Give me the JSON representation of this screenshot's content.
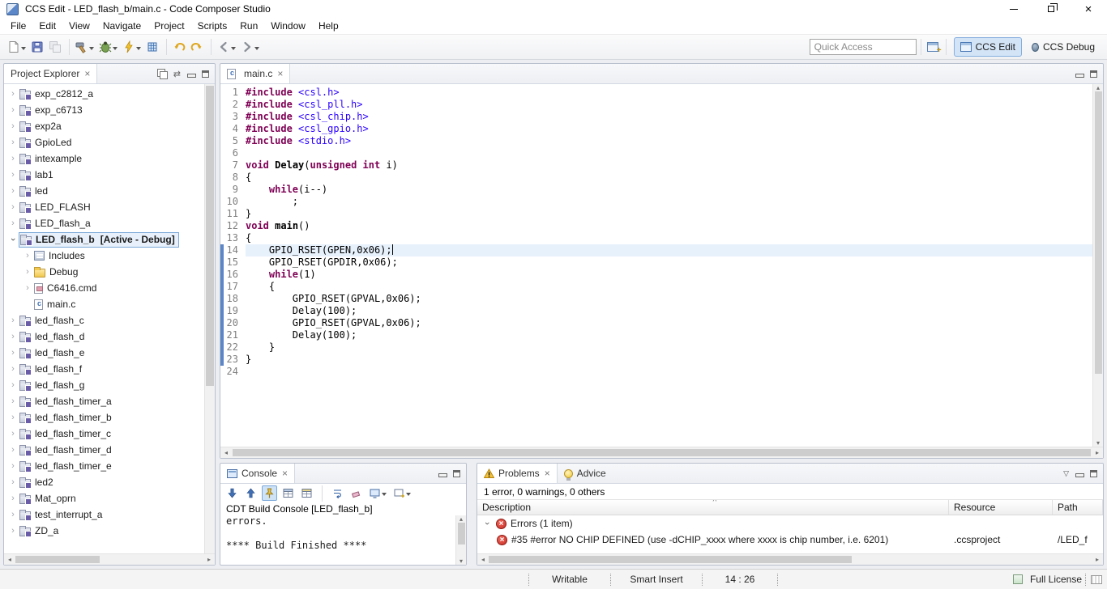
{
  "window": {
    "title": "CCS Edit - LED_flash_b/main.c - Code Composer Studio"
  },
  "menu_bar": {
    "items": [
      "File",
      "Edit",
      "View",
      "Navigate",
      "Project",
      "Scripts",
      "Run",
      "Window",
      "Help"
    ]
  },
  "toolbar": {
    "quick_access_placeholder": "Quick Access",
    "perspectives": [
      {
        "label": "CCS Edit",
        "active": true
      },
      {
        "label": "CCS Debug",
        "active": false
      }
    ]
  },
  "project_explorer": {
    "title": "Project Explorer",
    "items": [
      {
        "label": "exp_c2812_a",
        "type": "project"
      },
      {
        "label": "exp_c6713",
        "type": "project"
      },
      {
        "label": "exp2a",
        "type": "project"
      },
      {
        "label": "GpioLed",
        "type": "project"
      },
      {
        "label": "intexample",
        "type": "project"
      },
      {
        "label": "lab1",
        "type": "project"
      },
      {
        "label": "led",
        "type": "project"
      },
      {
        "label": "LED_FLASH",
        "type": "project"
      },
      {
        "label": "LED_flash_a",
        "type": "project"
      },
      {
        "label": "LED_flash_b",
        "suffix": "[Active - Debug]",
        "type": "project",
        "expanded": true,
        "selected": true,
        "children": [
          {
            "label": "Includes",
            "type": "includes"
          },
          {
            "label": "Debug",
            "type": "folder"
          },
          {
            "label": "C6416.cmd",
            "type": "cmdfile"
          },
          {
            "label": "main.c",
            "type": "cfile",
            "leaf": true
          }
        ]
      },
      {
        "label": "led_flash_c",
        "type": "project"
      },
      {
        "label": "led_flash_d",
        "type": "project"
      },
      {
        "label": "led_flash_e",
        "type": "project"
      },
      {
        "label": "led_flash_f",
        "type": "project"
      },
      {
        "label": "led_flash_g",
        "type": "project"
      },
      {
        "label": "led_flash_timer_a",
        "type": "project"
      },
      {
        "label": "led_flash_timer_b",
        "type": "project"
      },
      {
        "label": "led_flash_timer_c",
        "type": "project"
      },
      {
        "label": "led_flash_timer_d",
        "type": "project"
      },
      {
        "label": "led_flash_timer_e",
        "type": "project"
      },
      {
        "label": "led2",
        "type": "project"
      },
      {
        "label": "Mat_oprn",
        "type": "project"
      },
      {
        "label": "test_interrupt_a",
        "type": "project"
      },
      {
        "label": "ZD_a",
        "type": "project"
      }
    ]
  },
  "editor": {
    "tab": "main.c",
    "code": [
      {
        "tokens": [
          [
            "d",
            "#include"
          ],
          [
            "p",
            " "
          ],
          [
            "s",
            "<csl.h>"
          ]
        ]
      },
      {
        "tokens": [
          [
            "d",
            "#include"
          ],
          [
            "p",
            " "
          ],
          [
            "s",
            "<csl_pll.h>"
          ]
        ]
      },
      {
        "tokens": [
          [
            "d",
            "#include"
          ],
          [
            "p",
            " "
          ],
          [
            "s",
            "<csl_chip.h>"
          ]
        ]
      },
      {
        "tokens": [
          [
            "d",
            "#include"
          ],
          [
            "p",
            " "
          ],
          [
            "s",
            "<csl_gpio.h>"
          ]
        ]
      },
      {
        "tokens": [
          [
            "d",
            "#include"
          ],
          [
            "p",
            " "
          ],
          [
            "s",
            "<stdio.h>"
          ]
        ]
      },
      {
        "tokens": []
      },
      {
        "tokens": [
          [
            "k",
            "void"
          ],
          [
            "p",
            " "
          ],
          [
            "f",
            "Delay"
          ],
          [
            "p",
            "("
          ],
          [
            "k",
            "unsigned"
          ],
          [
            "p",
            " "
          ],
          [
            "k",
            "int"
          ],
          [
            "p",
            " i)"
          ]
        ]
      },
      {
        "tokens": [
          [
            "p",
            "{"
          ]
        ]
      },
      {
        "tokens": [
          [
            "p",
            "    "
          ],
          [
            "k",
            "while"
          ],
          [
            "p",
            "(i--)"
          ]
        ]
      },
      {
        "tokens": [
          [
            "p",
            "        ;"
          ]
        ]
      },
      {
        "tokens": [
          [
            "p",
            "}"
          ]
        ]
      },
      {
        "tokens": [
          [
            "k",
            "void"
          ],
          [
            "p",
            " "
          ],
          [
            "f",
            "main"
          ],
          [
            "p",
            "()"
          ]
        ]
      },
      {
        "tokens": [
          [
            "p",
            "{"
          ]
        ]
      },
      {
        "cur": true,
        "chg": true,
        "caret": true,
        "tokens": [
          [
            "p",
            "    GPIO_RSET(GPEN,0x06);"
          ]
        ]
      },
      {
        "chg": true,
        "tokens": [
          [
            "p",
            "    GPIO_RSET(GPDIR,0x06);"
          ]
        ]
      },
      {
        "chg": true,
        "tokens": [
          [
            "p",
            "    "
          ],
          [
            "k",
            "while"
          ],
          [
            "p",
            "(1)"
          ]
        ]
      },
      {
        "chg": true,
        "tokens": [
          [
            "p",
            "    {"
          ]
        ]
      },
      {
        "chg": true,
        "tokens": [
          [
            "p",
            "        GPIO_RSET(GPVAL,0x06);"
          ]
        ]
      },
      {
        "chg": true,
        "tokens": [
          [
            "p",
            "        Delay(100);"
          ]
        ]
      },
      {
        "chg": true,
        "tokens": [
          [
            "p",
            "        GPIO_RSET(GPVAL,0x06);"
          ]
        ]
      },
      {
        "chg": true,
        "tokens": [
          [
            "p",
            "        Delay(100);"
          ]
        ]
      },
      {
        "chg": true,
        "tokens": [
          [
            "p",
            "    }"
          ]
        ]
      },
      {
        "chg": true,
        "tokens": [
          [
            "p",
            "}"
          ]
        ]
      },
      {
        "tokens": []
      }
    ]
  },
  "console": {
    "tab": "Console",
    "header": "CDT Build Console [LED_flash_b]",
    "lines": [
      "errors.",
      "",
      "**** Build Finished ****"
    ]
  },
  "problems": {
    "tab": "Problems",
    "advice_tab": "Advice",
    "summary": "1 error, 0 warnings, 0 others",
    "columns": [
      "Description",
      "Resource",
      "Path"
    ],
    "group_label": "Errors (1 item)",
    "rows": [
      {
        "description": "#35 #error NO CHIP DEFINED (use -dCHIP_xxxx where xxxx is chip number, i.e. 6201)",
        "resource": ".ccsproject",
        "path": "/LED_f"
      }
    ]
  },
  "status_bar": {
    "writable": "Writable",
    "insert_mode": "Smart Insert",
    "cursor_position": "14 : 26",
    "license": "Full License"
  },
  "icons": {
    "close": "×",
    "expand": "›",
    "view_menu": "▽",
    "link_with_editor": "⇄",
    "sort_asc": "^",
    "up": "▴",
    "down": "▾",
    "left": "◂",
    "right": "▸"
  },
  "colors": {
    "keyword": "#7f0055",
    "string": "#2a00ff",
    "current_line": "#e7f1fc",
    "diff_bar": "#5d86c6",
    "error_red": "#c92d25",
    "active_perspective_bg": "#d3e4f7"
  }
}
